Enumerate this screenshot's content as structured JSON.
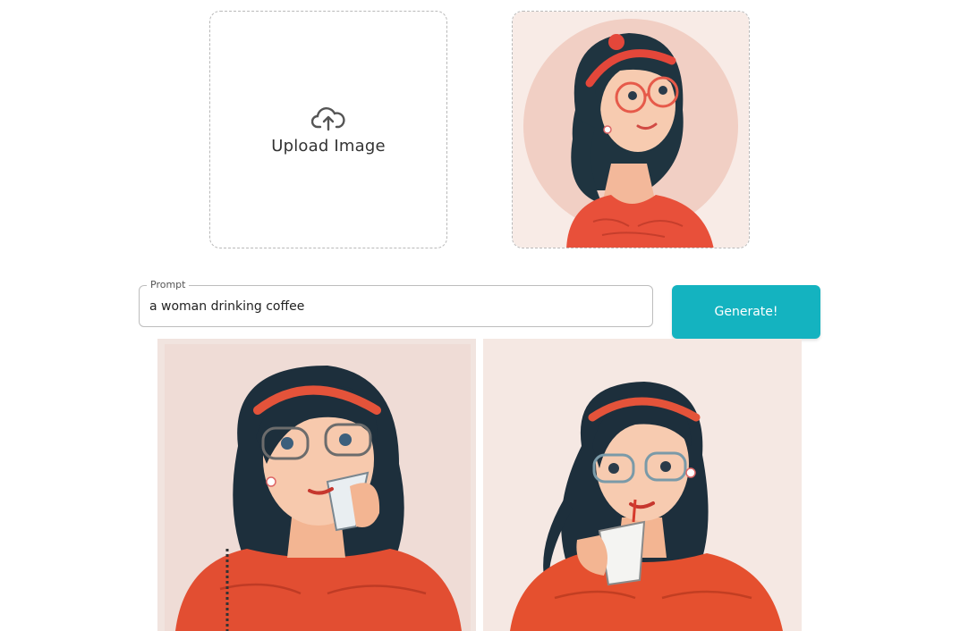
{
  "upload": {
    "label": "Upload Image",
    "icon": "cloud-upload-icon"
  },
  "reference_image": {
    "alt": "woman with red headband and glasses"
  },
  "prompt": {
    "label": "Prompt",
    "value": "a woman drinking coffee"
  },
  "generate": {
    "label": "Generate!"
  },
  "results": [
    {
      "alt": "generated image 1"
    },
    {
      "alt": "generated image 2"
    }
  ],
  "colors": {
    "accent": "#14b3c0",
    "shirt": "#e8503a",
    "hair": "#1f2f3f",
    "skin": "#f6c6a8",
    "background": "#f4e2dc"
  }
}
